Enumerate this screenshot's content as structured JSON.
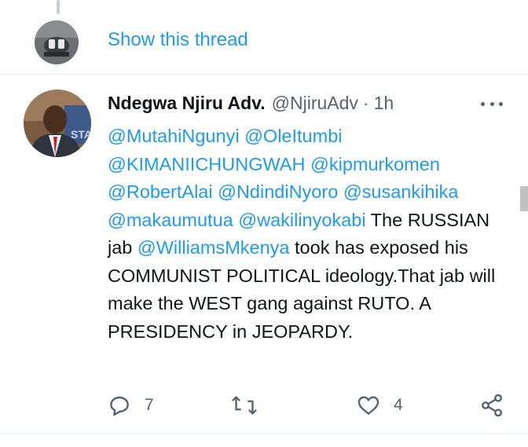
{
  "thread": {
    "show_thread_label": "Show this thread"
  },
  "tweet": {
    "display_name": "Ndegwa Njiru Adv.",
    "handle": "@NjiruAdv",
    "separator": "·",
    "time": "1h",
    "text_segments": [
      {
        "text": "@MutahiNgunyi",
        "mention": true
      },
      {
        "text": " ",
        "mention": false
      },
      {
        "text": "@OleItumbi",
        "mention": true
      },
      {
        "text": " ",
        "mention": false
      },
      {
        "text": "@KIMANIICHUNGWAH",
        "mention": true
      },
      {
        "text": " ",
        "mention": false
      },
      {
        "text": "@kipmurkomen",
        "mention": true
      },
      {
        "text": " ",
        "mention": false
      },
      {
        "text": "@RobertAlai",
        "mention": true
      },
      {
        "text": " ",
        "mention": false
      },
      {
        "text": "@NdindiNyoro",
        "mention": true
      },
      {
        "text": " ",
        "mention": false
      },
      {
        "text": "@susankihika",
        "mention": true
      },
      {
        "text": " ",
        "mention": false
      },
      {
        "text": "@makaumutua",
        "mention": true
      },
      {
        "text": " ",
        "mention": false
      },
      {
        "text": "@wakilinyokabi",
        "mention": true
      },
      {
        "text": " The RUSSIAN jab ",
        "mention": false
      },
      {
        "text": "@WilliamsMkenya",
        "mention": true
      },
      {
        "text": " took has exposed his COMMUNIST POLITICAL ideology.That jab will make the WEST gang against RUTO.  A PRESIDENCY in JEOPARDY.",
        "mention": false
      }
    ],
    "actions": {
      "reply_count": "7",
      "retweet_count": "",
      "like_count": "4"
    }
  },
  "icons": {
    "reply": "reply-icon",
    "retweet": "retweet-icon",
    "like": "heart-icon",
    "share": "share-icon",
    "more": "more-options-icon"
  },
  "colors": {
    "accent": "#1d9bf0",
    "text": "#0f1419",
    "muted": "#536471",
    "divider": "#e6ecf0"
  }
}
